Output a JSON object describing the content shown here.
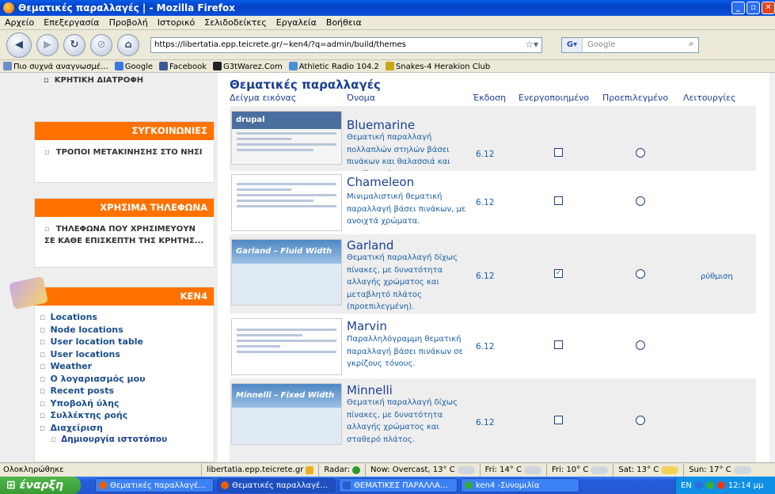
{
  "window": {
    "title": "Θεματικές παραλλαγές | - Mozilla Firefox"
  },
  "menu": [
    "Αρχείο",
    "Επεξεργασία",
    "Προβολή",
    "Ιστορικό",
    "Σελιδοδείκτες",
    "Εργαλεία",
    "Βοήθεια"
  ],
  "url": "https://libertatia.epp.teicrete.gr/~ken4/?q=admin/build/themes",
  "search_placeholder": "Google",
  "bookmarks": [
    "Πιο συχνά αναγνωσμέ...",
    "Google",
    "Facebook",
    "G3tWarez.Com",
    "Athletic Radio 104.2",
    "Snakes-4 Herakion Club"
  ],
  "sidebar": {
    "top_item": "ΚΡΗΤΙΚΗ ΔΙΑΤΡΟΦΗ",
    "blocks": [
      {
        "title": "ΣΥΓΚΟΙΝΩΝΙΕΣ",
        "items": [
          "ΤΡΟΠΟΙ ΜΕΤΑΚΙΝΗΣΗΣ ΣΤΟ ΝΗΣΙ"
        ]
      },
      {
        "title": "ΧΡΗΣΙΜΑ ΤΗΛΕΦΩΝΑ",
        "items": [
          "ΤΗΛΕΦΩΝΑ ΠΟΥ ΧΡΗΣΙΜΕΥΟΥΝ ΣΕ ΚΑΘΕ ΕΠΙΣΚΕΠΤΗ ΤΗΣ ΚΡΗΤΗΣ..."
        ]
      },
      {
        "title": "KEN4",
        "items": []
      }
    ],
    "nav": [
      "Locations",
      "Node locations",
      "User location table",
      "User locations",
      "Weather",
      "Ο λογαριασμός μου",
      "Recent posts",
      "Υποβολή ύλης",
      "Συλλέκτης ροής",
      "Διαχείριση"
    ],
    "nav_sub": "Δημιουργία ιστοτόπου"
  },
  "main": {
    "title": "Θεματικές παραλλαγές",
    "headers": {
      "screenshot": "Δείγμα εικόνας",
      "name": "Όνομα",
      "version": "Έκδοση",
      "enabled": "Ενεργοποιημένο",
      "default": "Προεπιλεγμένο",
      "ops": "Λειτουργίες"
    },
    "themes": [
      {
        "name": "Bluemarine",
        "desc": "Θεματική παραλλαγή πολλαπλών στηλών βάσει πινάκων και θαλασσιά και γκρίζα χρώματα.",
        "version": "6.12",
        "enabled": false,
        "default": false,
        "op": "",
        "shot": "drupal"
      },
      {
        "name": "Chameleon",
        "desc": "Μινιμαλιστική θεματική παραλλαγή βάσει πινάκων, με ανοιχτά χρώματα.",
        "version": "6.12",
        "enabled": false,
        "default": false,
        "op": "",
        "shot": ""
      },
      {
        "name": "Garland",
        "desc": "Θεματική παραλλαγή δίχως πίνακες, με δυνατότητα αλλαγής χρώματος και μεταβλητό πλάτος (προεπιλεγμένη).",
        "version": "6.12",
        "enabled": true,
        "default": false,
        "op": "ρύθμιση",
        "shot": "Garland – Fluid Width"
      },
      {
        "name": "Marvin",
        "desc": "Παραλληλόγραμμη θεματική παραλλαγή βάσει πινάκων σε γκρίζους τόνους.",
        "version": "6.12",
        "enabled": false,
        "default": false,
        "op": "",
        "shot": ""
      },
      {
        "name": "Minnelli",
        "desc": "Θεματική παραλλαγή δίχως πίνακες, με δυνατότητα αλλαγής χρώματος και σταθερό πλάτος.",
        "version": "6.12",
        "enabled": false,
        "default": false,
        "op": "",
        "shot": "Minnelli – Fixed Width"
      }
    ]
  },
  "status": {
    "left": "Ολοκληρώθηκε",
    "host": "libertatia.epp.teicrete.gr",
    "radar": "Radar:",
    "now": "Now: Overcast, 13° C",
    "f1": "Fri: 14° C",
    "f2": "Fri: 10° C",
    "f3": "Sat: 13° C",
    "f4": "Sun: 17° C"
  },
  "taskbar": {
    "start": "έναρξη",
    "tasks": [
      "Θεματικές παραλλαγέ...",
      "Θεματικές παραλλαγέ...",
      "ΘΕΜΑΤΙΚΕΣ ΠΑΡΑΛΛΑ...",
      "ken4 -Συνομιλία"
    ],
    "lang": "EN",
    "time": "12:14 μμ"
  }
}
